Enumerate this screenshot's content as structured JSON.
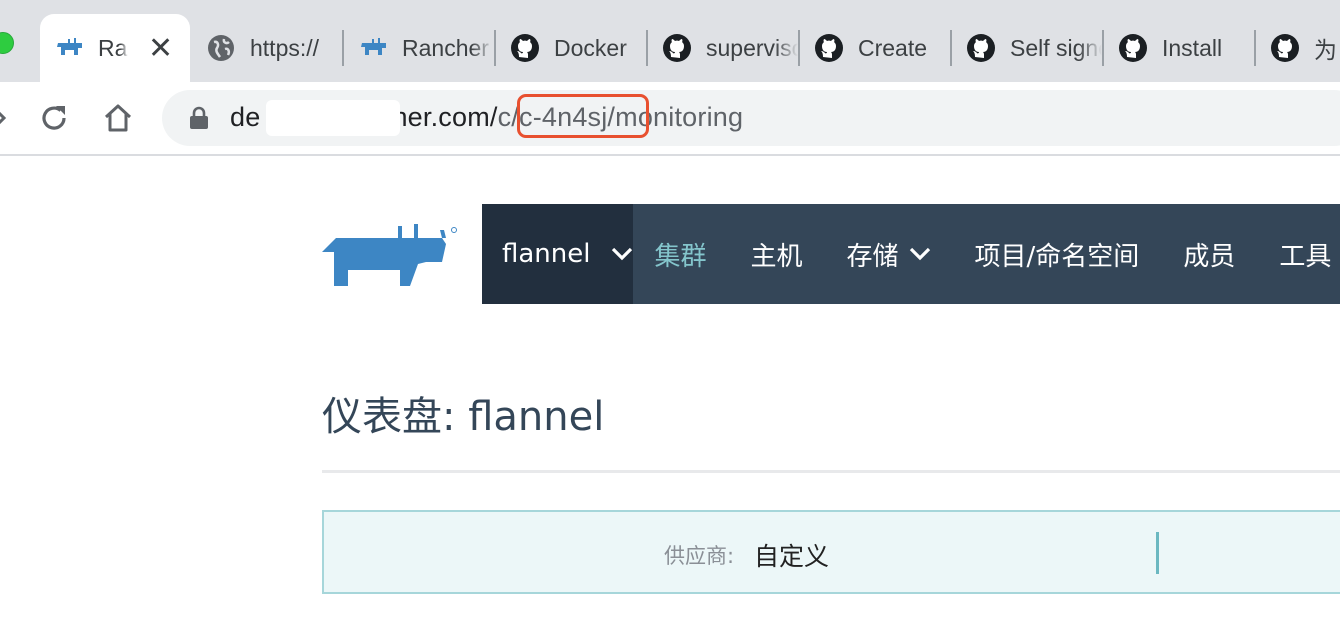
{
  "browser": {
    "tabs": [
      {
        "title": "Rancher",
        "favicon": "rancher-icon",
        "active": true
      },
      {
        "title": "https://",
        "favicon": "globe-icon",
        "active": false
      },
      {
        "title": "Rancher",
        "favicon": "rancher-icon",
        "active": false
      },
      {
        "title": "Docker",
        "favicon": "github-icon",
        "active": false
      },
      {
        "title": "supervisor",
        "favicon": "github-icon",
        "active": false
      },
      {
        "title": "Create",
        "favicon": "github-icon",
        "active": false
      },
      {
        "title": "Self signed",
        "favicon": "github-icon",
        "active": false
      },
      {
        "title": "Install",
        "favicon": "github-icon",
        "active": false
      },
      {
        "title": "为",
        "favicon": "github-icon",
        "active": false
      }
    ],
    "close_glyph": "✕",
    "address": {
      "host_visible_start": "de",
      "host_visible_end": "her.com/",
      "path_pre": "c",
      "path_highlight": "/c-4n4sj/",
      "path_post": "monitoring"
    },
    "highlight_color": "#e8502f"
  },
  "nav": {
    "cluster_name": "flannel",
    "items": [
      {
        "label": "集群",
        "active": true,
        "dropdown": false
      },
      {
        "label": "主机",
        "active": false,
        "dropdown": false
      },
      {
        "label": "存储",
        "active": false,
        "dropdown": true
      },
      {
        "label": "项目/命名空间",
        "active": false,
        "dropdown": false
      },
      {
        "label": "成员",
        "active": false,
        "dropdown": false
      },
      {
        "label": "工具",
        "active": false,
        "dropdown": false
      }
    ],
    "bg_color": "#344658",
    "active_color": "#84c5cc"
  },
  "page": {
    "title": "仪表盘: flannel",
    "provider_label": "供应商:",
    "provider_value": "自定义"
  }
}
